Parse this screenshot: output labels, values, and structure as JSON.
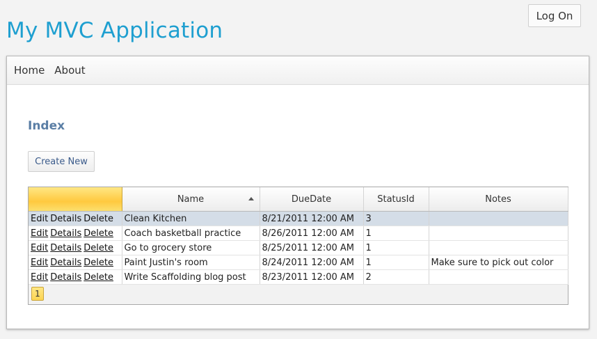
{
  "header": {
    "app_title": "My MVC Application",
    "logon_label": "Log On"
  },
  "menu": {
    "items": [
      "Home",
      "About"
    ]
  },
  "page": {
    "title": "Index",
    "create_label": "Create New"
  },
  "grid": {
    "columns": [
      "",
      "Name",
      "DueDate",
      "StatusId",
      "Notes"
    ],
    "sorted_column": "Name",
    "sort_direction": "ascending",
    "actions": [
      "Edit",
      "Details",
      "Delete"
    ],
    "rows": [
      {
        "name": "Clean Kitchen",
        "due": "8/21/2011 12:00 AM",
        "status": "3",
        "notes": "",
        "selected": true
      },
      {
        "name": "Coach basketball practice",
        "due": "8/26/2011 12:00 AM",
        "status": "1",
        "notes": ""
      },
      {
        "name": "Go to grocery store",
        "due": "8/25/2011 12:00 AM",
        "status": "1",
        "notes": ""
      },
      {
        "name": "Paint Justin's room",
        "due": "8/24/2011 12:00 AM",
        "status": "1",
        "notes": "Make sure to pick out color"
      },
      {
        "name": "Write Scaffolding blog post",
        "due": "8/23/2011 12:00 AM",
        "status": "2",
        "notes": ""
      }
    ],
    "pager": {
      "current_page": "1"
    }
  },
  "colors": {
    "title": "#1e9fd0",
    "heading": "#5a7ea5",
    "selected_row": "#d4dde7",
    "highlight": "#ffc93f"
  }
}
